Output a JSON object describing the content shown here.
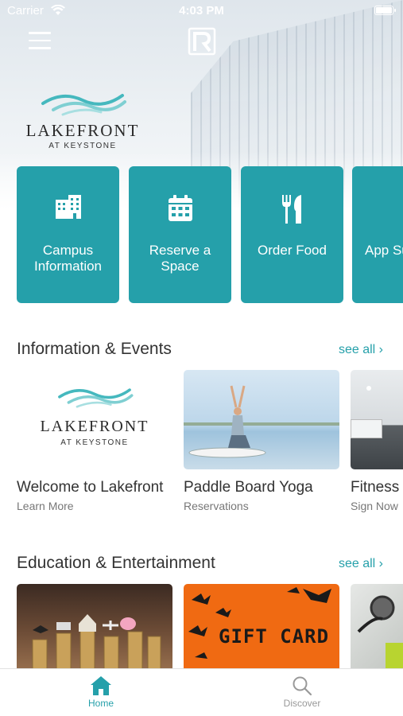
{
  "status_bar": {
    "carrier": "Carrier",
    "time": "4:03 PM"
  },
  "hero": {
    "brand_text": "",
    "logo_name": "LAKEFRONT",
    "logo_sub": "AT KEYSTONE"
  },
  "tiles": [
    {
      "label": "Campus Information",
      "icon": "building-icon"
    },
    {
      "label": "Reserve a Space",
      "icon": "calendar-icon"
    },
    {
      "label": "Order Food",
      "icon": "fork-knife-icon"
    },
    {
      "label": "App Su",
      "icon": "question-icon"
    }
  ],
  "info_section": {
    "title": "Information & Events",
    "see_all": "see all",
    "cards": [
      {
        "title": "Welcome to Lakefront",
        "subtitle": "Learn More",
        "logo_name": "LAKEFRONT",
        "logo_sub": "AT KEYSTONE"
      },
      {
        "title": "Paddle Board Yoga",
        "subtitle": "Reservations"
      },
      {
        "title": "Fitness",
        "subtitle": "Sign Now"
      }
    ]
  },
  "edu_section": {
    "title": "Education & Entertainment",
    "see_all": "see all",
    "cards": [
      {
        "image": "coins-house-image"
      },
      {
        "image": "gift-card-image",
        "text": "GIFT CARD"
      },
      {
        "image": "stethoscope-image"
      }
    ]
  },
  "tabbar": {
    "home": "Home",
    "discover": "Discover"
  },
  "colors": {
    "accent": "#25a0aa",
    "text": "#333333",
    "muted": "#777777"
  }
}
